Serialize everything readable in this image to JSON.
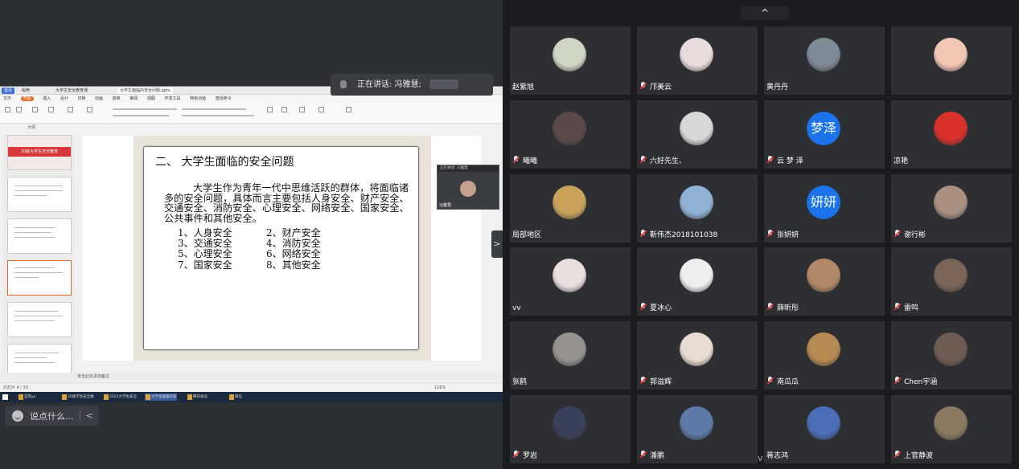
{
  "shared_screen": {
    "wps": {
      "tabs": [
        "首页",
        "稻壳",
        "大学生安全教育课",
        "大学生面临的安全问题.pptx"
      ],
      "menu": [
        "文件",
        "开始",
        "插入",
        "设计",
        "切换",
        "动画",
        "放映",
        "审阅",
        "视图",
        "开发工具",
        "特色功能",
        "查找命令"
      ],
      "thumb_label": "大纲",
      "thumb_title": "20级大学生安全教育",
      "notes_placeholder": "单击此处添加备注",
      "statusbar": "幻灯片 4 / 10",
      "zoom": "126%"
    },
    "slide": {
      "title": "二、 大学生面临的安全问题",
      "paragraph": "大学生作为青年一代中思维活跃的群体，将面临诸多的安全问题，具体而言主要包括人身安全、财产安全、交通安全、消防安全、心理安全、网络安全、国家安全、公共事件和其他安全。",
      "items": [
        "1、人身安全",
        "2、财产安全",
        "3、交通安全",
        "4、消防安全",
        "5、心理安全",
        "6、网络安全",
        "7、国家安全",
        "8、其他安全"
      ]
    },
    "mini_video": {
      "header": "正在讲话: 冯雅慧",
      "name": "冯雅慧"
    },
    "taskbar": [
      "宜宾yy",
      "20级学生安全教",
      "2021大学生安全",
      "大学生面临的安",
      "腾讯会议",
      "微信"
    ]
  },
  "chat": {
    "placeholder": "说点什么...",
    "collapse": "<"
  },
  "collapse_panel": ">",
  "gallery": {
    "top_toggle": "^",
    "scroll_down": "v",
    "speaking": {
      "label": "正在讲话: 冯雅慧;"
    },
    "participants": [
      {
        "name": "赵紫旭",
        "muted": false,
        "avatar_color": "#cfd6c4"
      },
      {
        "name": "邝美云",
        "muted": true,
        "avatar_color": "#e8dcdc"
      },
      {
        "name": "黄丹丹",
        "muted": false,
        "avatar_color": "#7e8a96"
      },
      {
        "name": "",
        "muted": false,
        "avatar_color": "#f3c7b4"
      },
      {
        "name": "曦曦",
        "muted": true,
        "avatar_color": "#5b4a4a"
      },
      {
        "name": "六好先生、",
        "muted": true,
        "avatar_color": "#d8d8d8"
      },
      {
        "name": "云 梦 泽",
        "muted": true,
        "avatar_text": "梦泽",
        "avatar_color": "#1a73e8"
      },
      {
        "name": "凉艳",
        "muted": false,
        "avatar_color": "#d8302a"
      },
      {
        "name": "局部地区",
        "muted": false,
        "avatar_color": "#caa35a"
      },
      {
        "name": "靳伟杰2018101038",
        "muted": true,
        "avatar_color": "#8fb2d6"
      },
      {
        "name": "张妍妍",
        "muted": true,
        "avatar_text": "妍妍",
        "avatar_color": "#1a73e8"
      },
      {
        "name": "谢行彬",
        "muted": true,
        "avatar_color": "#a88f80"
      },
      {
        "name": "vv",
        "muted": false,
        "avatar_color": "#e9dede"
      },
      {
        "name": "夏冰心",
        "muted": true,
        "avatar_color": "#eeeeee"
      },
      {
        "name": "薛昕彤",
        "muted": true,
        "avatar_color": "#b38868"
      },
      {
        "name": "雷鸣",
        "muted": true,
        "avatar_color": "#7b6458"
      },
      {
        "name": "张鹤",
        "muted": false,
        "avatar_color": "#95928f"
      },
      {
        "name": "郭溢辉",
        "muted": true,
        "avatar_color": "#e9dcd2"
      },
      {
        "name": "南瓜瓜",
        "muted": true,
        "avatar_color": "#b68a53"
      },
      {
        "name": "Chen宇涵",
        "muted": true,
        "avatar_color": "#6e5c53"
      },
      {
        "name": "罗岩",
        "muted": true,
        "avatar_color": "#39405a"
      },
      {
        "name": "潘鹏",
        "muted": true,
        "avatar_color": "#5d7aa8"
      },
      {
        "name": "蒋志鸿",
        "muted": false,
        "avatar_color": "#4b6fb8"
      },
      {
        "name": "上官静波",
        "muted": true,
        "avatar_color": "#8b7a62"
      }
    ]
  }
}
